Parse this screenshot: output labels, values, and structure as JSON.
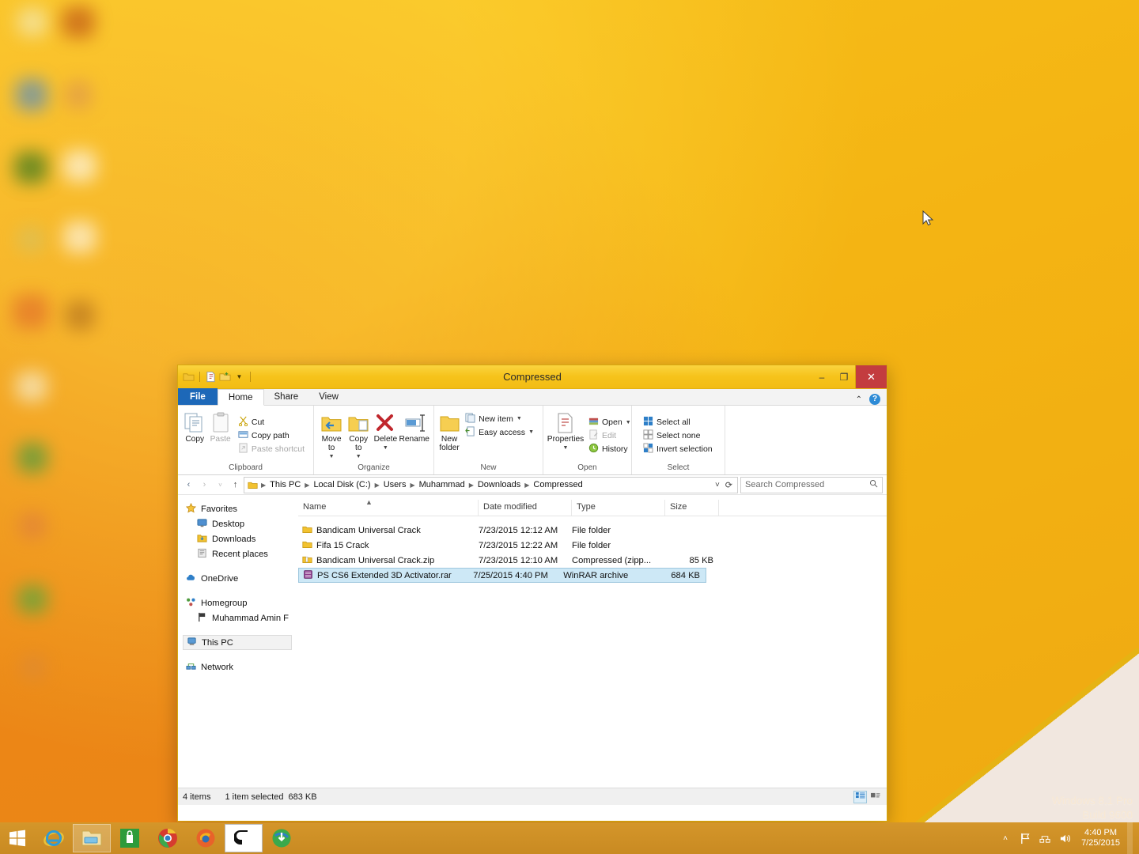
{
  "desktop": {
    "watermark_line1": "Windows 8.1 Pro",
    "watermark_line2": "Build 9600"
  },
  "window": {
    "title": "Compressed",
    "quick_access": [
      {
        "name": "folder-icon"
      },
      {
        "name": "properties-icon"
      },
      {
        "name": "new-folder-icon"
      },
      {
        "name": "chevron-down-icon"
      }
    ],
    "controls": {
      "minimize": "–",
      "maximize": "❐",
      "close": "✕"
    },
    "tabs": [
      {
        "label": "File",
        "kind": "file"
      },
      {
        "label": "Home",
        "kind": "active"
      },
      {
        "label": "Share",
        "kind": "normal"
      },
      {
        "label": "View",
        "kind": "normal"
      }
    ],
    "ribbon_collapse": "⌃",
    "help_label": "?"
  },
  "ribbon": {
    "groups": [
      {
        "label": "Clipboard",
        "big": [
          {
            "label": "Copy",
            "icon": "copy-icon",
            "disabled": false
          },
          {
            "label": "Paste",
            "icon": "paste-icon",
            "disabled": true
          }
        ],
        "small": [
          {
            "label": "Cut",
            "icon": "cut-icon",
            "disabled": false
          },
          {
            "label": "Copy path",
            "icon": "copy-path-icon",
            "disabled": false
          },
          {
            "label": "Paste shortcut",
            "icon": "paste-shortcut-icon",
            "disabled": true
          }
        ]
      },
      {
        "label": "Organize",
        "big": [
          {
            "label": "Move to",
            "icon": "move-to-icon",
            "dropdown": true
          },
          {
            "label": "Copy to",
            "icon": "copy-to-icon",
            "dropdown": true
          },
          {
            "label": "Delete",
            "icon": "delete-icon",
            "dropdown": true
          },
          {
            "label": "Rename",
            "icon": "rename-icon",
            "dropdown": false
          }
        ],
        "small": []
      },
      {
        "label": "New",
        "big": [
          {
            "label": "New folder",
            "icon": "new-folder-icon",
            "dropdown": false
          }
        ],
        "small": [
          {
            "label": "New item",
            "icon": "new-item-icon",
            "dropdown": true
          },
          {
            "label": "Easy access",
            "icon": "easy-access-icon",
            "dropdown": true
          }
        ]
      },
      {
        "label": "Open",
        "big": [
          {
            "label": "Properties",
            "icon": "properties-icon",
            "dropdown": true
          }
        ],
        "small": [
          {
            "label": "Open",
            "icon": "open-icon",
            "dropdown": true,
            "disabled": false
          },
          {
            "label": "Edit",
            "icon": "edit-icon",
            "disabled": true
          },
          {
            "label": "History",
            "icon": "history-icon",
            "disabled": false
          }
        ]
      },
      {
        "label": "Select",
        "big": [],
        "small": [
          {
            "label": "Select all",
            "icon": "select-all-icon"
          },
          {
            "label": "Select none",
            "icon": "select-none-icon"
          },
          {
            "label": "Invert selection",
            "icon": "invert-selection-icon"
          }
        ]
      }
    ]
  },
  "address": {
    "back": "‹",
    "forward": "›",
    "recent": "˅",
    "up": "↑",
    "breadcrumbs": [
      "This PC",
      "Local Disk (C:)",
      "Users",
      "Muhammad",
      "Downloads",
      "Compressed"
    ],
    "dropdown": "˅",
    "refresh": "⟳",
    "search_placeholder": "Search Compressed"
  },
  "nav_pane": {
    "items": [
      {
        "label": "Favorites",
        "icon": "star-icon",
        "indent": false,
        "selected": false
      },
      {
        "label": "Desktop",
        "icon": "desktop-icon",
        "indent": true,
        "selected": false
      },
      {
        "label": "Downloads",
        "icon": "downloads-icon",
        "indent": true,
        "selected": false
      },
      {
        "label": "Recent places",
        "icon": "recent-places-icon",
        "indent": true,
        "selected": false
      },
      {
        "label": "OneDrive",
        "icon": "onedrive-icon",
        "indent": false,
        "selected": false,
        "gap_before": true
      },
      {
        "label": "Homegroup",
        "icon": "homegroup-icon",
        "indent": false,
        "selected": false,
        "gap_before": true
      },
      {
        "label": "Muhammad Amin F",
        "icon": "user-icon",
        "indent": true,
        "selected": false
      },
      {
        "label": "This PC",
        "icon": "this-pc-icon",
        "indent": false,
        "selected": true,
        "gap_before": true
      },
      {
        "label": "Network",
        "icon": "network-icon",
        "indent": false,
        "selected": false,
        "gap_before": true
      }
    ]
  },
  "file_list": {
    "columns": [
      "Name",
      "Date modified",
      "Type",
      "Size"
    ],
    "sort_indicator": "▲",
    "rows": [
      {
        "name": "Bandicam Universal Crack",
        "date": "7/23/2015 12:12 AM",
        "type": "File folder",
        "size": "",
        "icon": "folder-icon",
        "selected": false
      },
      {
        "name": "Fifa 15 Crack",
        "date": "7/23/2015 12:22 AM",
        "type": "File folder",
        "size": "",
        "icon": "folder-icon",
        "selected": false
      },
      {
        "name": "Bandicam Universal Crack.zip",
        "date": "7/23/2015 12:10 AM",
        "type": "Compressed (zipp...",
        "size": "85 KB",
        "icon": "zip-icon",
        "selected": false
      },
      {
        "name": "PS CS6 Extended 3D Activator.rar",
        "date": "7/25/2015 4:40 PM",
        "type": "WinRAR archive",
        "size": "684 KB",
        "icon": "rar-icon",
        "selected": true
      }
    ]
  },
  "status_bar": {
    "item_count": "4 items",
    "selection": "1 item selected",
    "selection_size": "683 KB",
    "views": [
      {
        "name": "details-view-button",
        "active": true
      },
      {
        "name": "large-icons-view-button",
        "active": false
      }
    ]
  },
  "taskbar": {
    "start": "start-button",
    "buttons": [
      {
        "name": "taskbar-internet-explorer",
        "label": "Internet Explorer",
        "open": false
      },
      {
        "name": "taskbar-file-explorer",
        "label": "File Explorer",
        "open": true
      },
      {
        "name": "taskbar-store",
        "label": "Store",
        "open": false
      },
      {
        "name": "taskbar-chrome",
        "label": "Google Chrome",
        "open": false
      },
      {
        "name": "taskbar-firefox",
        "label": "Mozilla Firefox",
        "open": false
      },
      {
        "name": "taskbar-camtasia",
        "label": "Camtasia",
        "open": true
      },
      {
        "name": "taskbar-idm",
        "label": "Internet Download Manager",
        "open": false
      }
    ],
    "tray": {
      "show_hidden": "˄",
      "action_center": "action-center-icon",
      "network": "network-tray-icon",
      "volume": "volume-icon",
      "time": "4:40 PM",
      "date": "7/25/2015"
    }
  }
}
